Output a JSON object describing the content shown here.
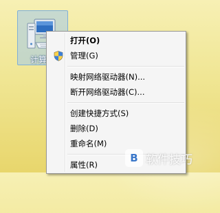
{
  "desktop_icon": {
    "label": "计算机",
    "icon": "computer-icon"
  },
  "context_menu": {
    "items": [
      {
        "label": "打开(O)",
        "bold": true
      },
      {
        "label": "管理(G)",
        "icon": "uac-shield-icon"
      },
      {
        "label": "映射网络驱动器(N)..."
      },
      {
        "label": "断开网络驱动器(C)..."
      },
      {
        "label": "创建快捷方式(S)"
      },
      {
        "label": "删除(D)"
      },
      {
        "label": "重命名(M)"
      },
      {
        "label": "属性(R)"
      }
    ]
  },
  "watermark": {
    "badge": "B",
    "text": "软件技巧"
  },
  "colors": {
    "menu_background": "#f5f5f5",
    "menu_border": "#979797",
    "desktop_background": "#f0e694",
    "selection_tile": "#a0c8eb"
  }
}
